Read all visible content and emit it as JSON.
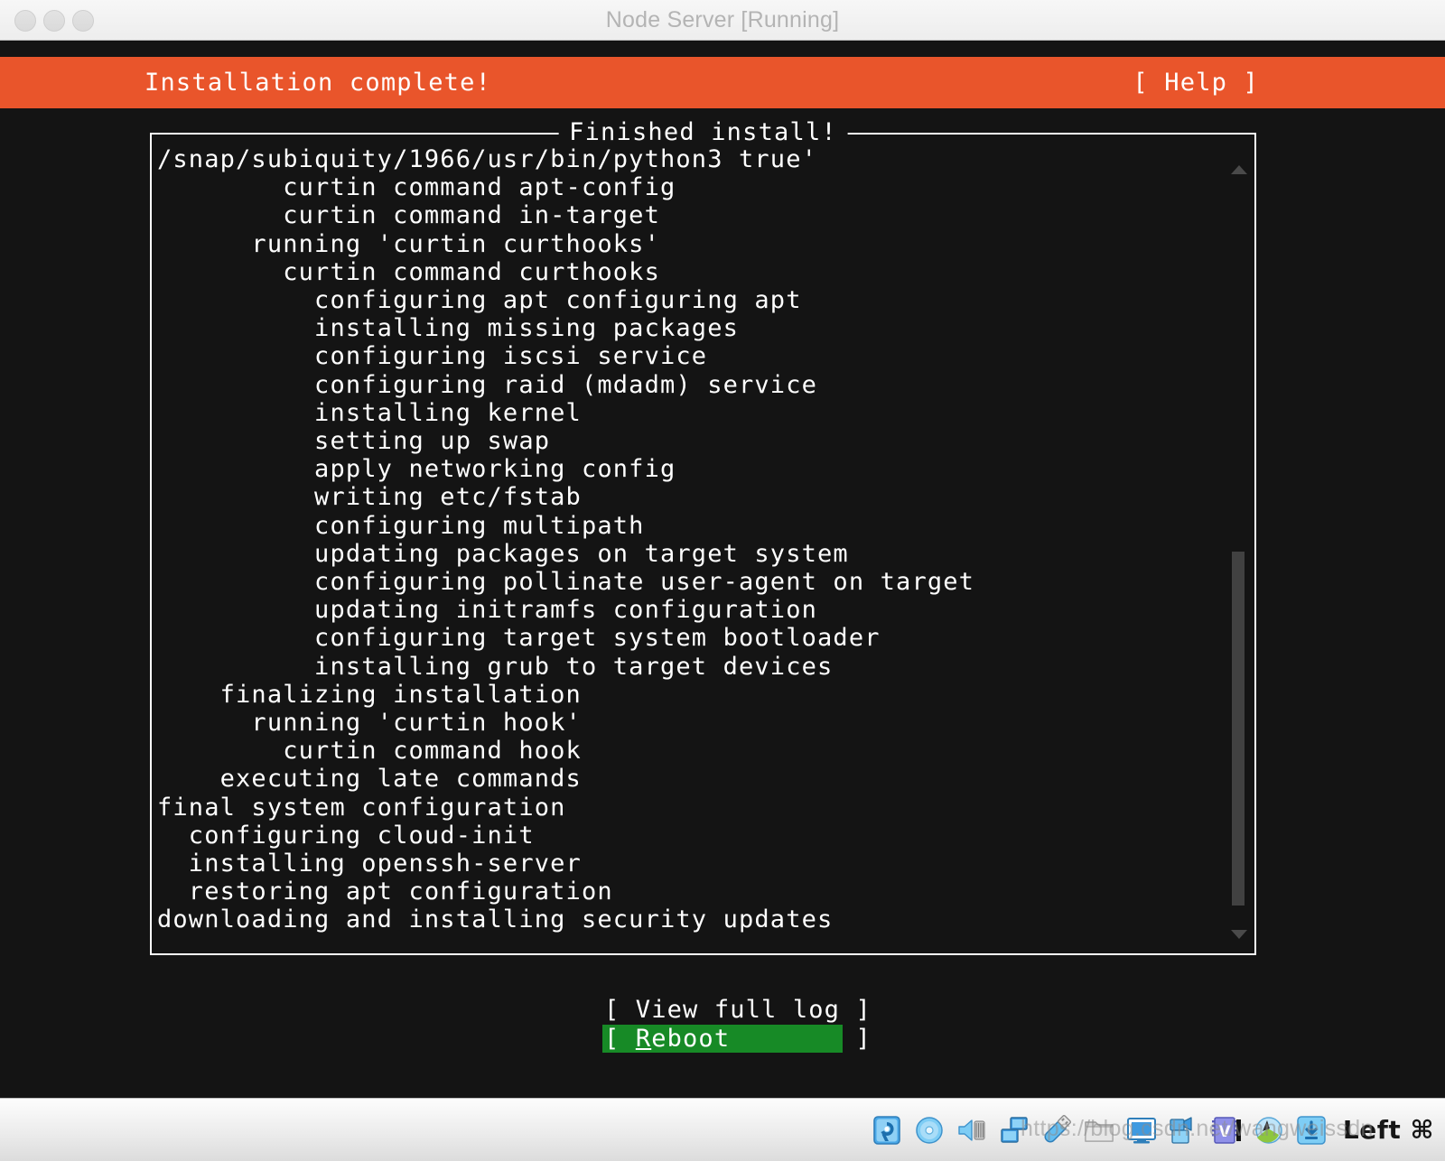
{
  "window": {
    "title": "Node Server [Running]",
    "traffic_lights": [
      "close",
      "minimize",
      "zoom"
    ]
  },
  "installer": {
    "header_title": "Installation complete!",
    "help_label": "[ Help ]",
    "header_bg": "#e9552b",
    "frame_title": "Finished install!",
    "log_lines": [
      "/snap/subiquity/1966/usr/bin/python3 true'",
      "        curtin command apt-config",
      "        curtin command in-target",
      "      running 'curtin curthooks'",
      "        curtin command curthooks",
      "          configuring apt configuring apt",
      "          installing missing packages",
      "          configuring iscsi service",
      "          configuring raid (mdadm) service",
      "          installing kernel",
      "          setting up swap",
      "          apply networking config",
      "          writing etc/fstab",
      "          configuring multipath",
      "          updating packages on target system",
      "          configuring pollinate user-agent on target",
      "          updating initramfs configuration",
      "          configuring target system bootloader",
      "          installing grub to target devices",
      "    finalizing installation",
      "      running 'curtin hook'",
      "        curtin command hook",
      "    executing late commands",
      "final system configuration",
      "  configuring cloud-init",
      "  installing openssh-server",
      "  restoring apt configuration",
      "downloading and installing security updates"
    ],
    "buttons": [
      {
        "label": "[ View full log ]",
        "selected": false,
        "accel": ""
      },
      {
        "label": "[ Reboot        ]",
        "selected": true,
        "accel": "R"
      }
    ],
    "selected_color": "#178a26"
  },
  "scrollbar": {
    "up_arrow": "scroll-up-arrow",
    "down_arrow": "scroll-down-arrow",
    "thumb": "scroll-thumb"
  },
  "statusbar": {
    "icons": [
      "hard-disk-icon",
      "optical-disk-icon",
      "audio-icon",
      "network-icon",
      "usb-icon",
      "shared-folder-icon",
      "display-icon",
      "recording-icon",
      "virtualization-icon",
      "mouse-integration-icon",
      "host-key-icon"
    ],
    "host_key": "Left ⌘"
  },
  "watermark": "https://blog.csdn.net/wangweissdn"
}
